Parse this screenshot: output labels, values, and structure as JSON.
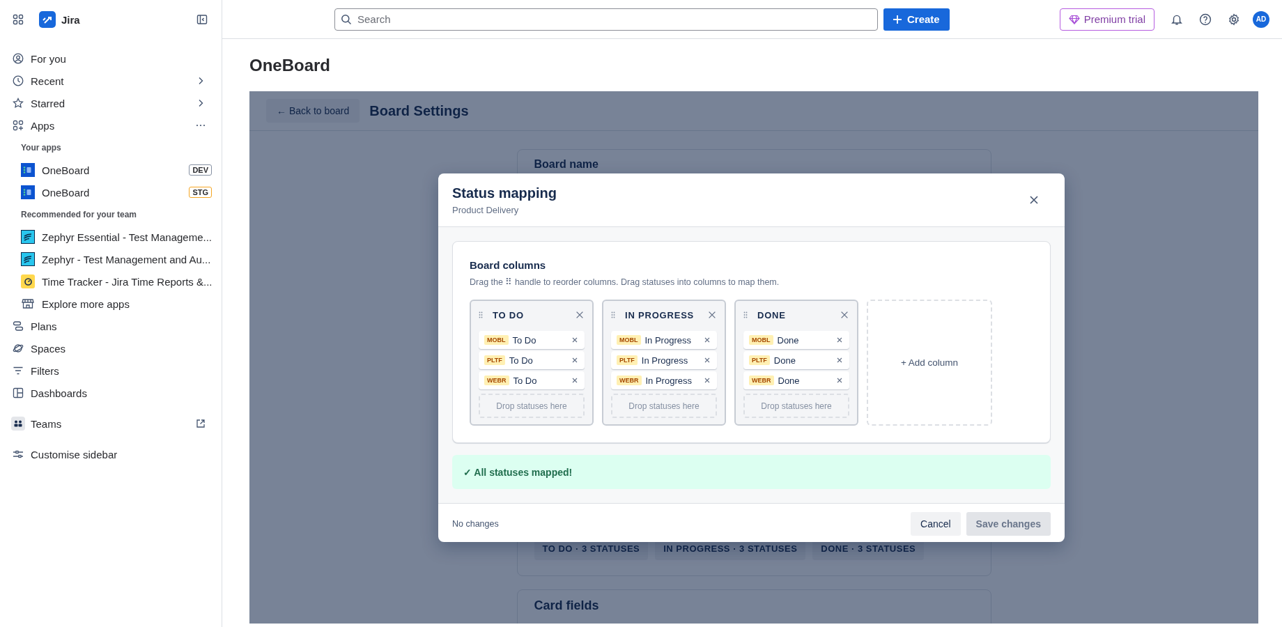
{
  "sidebar": {
    "product": "Jira",
    "groups": [
      [
        {
          "kind": "nav",
          "label": "For you"
        },
        {
          "kind": "nav",
          "label": "Recent",
          "chevron": true
        },
        {
          "kind": "nav",
          "label": "Starred",
          "chevron": true
        },
        {
          "kind": "nav",
          "label": "Apps",
          "more_menu": true
        },
        {
          "kind": "heading",
          "label": "Your apps"
        },
        {
          "kind": "app",
          "label": "OneBoard",
          "badge": {
            "text": "DEV",
            "color": "#8590a2"
          }
        },
        {
          "kind": "app",
          "label": "OneBoard",
          "badge": {
            "text": "STG",
            "color": "#f5a623"
          }
        },
        {
          "kind": "heading",
          "label": "Recommended for your team"
        },
        {
          "kind": "app",
          "label": "Zephyr Essential - Test Manageme..."
        },
        {
          "kind": "app",
          "label": "Zephyr - Test Management and Au..."
        },
        {
          "kind": "app",
          "label": "Time Tracker - Jira Time Reports &..."
        },
        {
          "kind": "app",
          "label": "Explore more apps"
        },
        {
          "kind": "nav",
          "label": "Plans"
        },
        {
          "kind": "nav",
          "label": "Spaces"
        },
        {
          "kind": "nav",
          "label": "Filters"
        },
        {
          "kind": "nav",
          "label": "Dashboards"
        }
      ],
      [
        {
          "kind": "nav",
          "label": "Teams",
          "external_link": true
        }
      ],
      [
        {
          "kind": "nav",
          "label": "Customise sidebar"
        }
      ]
    ]
  },
  "topbar": {
    "search": {
      "placeholder": "Search"
    },
    "create": "Create",
    "premium": "Premium trial",
    "avatar": "AD"
  },
  "page": {
    "title": "OneBoard"
  },
  "app": {
    "back": "← Back to board",
    "title": "Board Settings",
    "board_name_label": "Board name",
    "summary": [
      "TO DO · 3 STATUSES",
      "IN PROGRESS · 3 STATUSES",
      "DONE · 3 STATUSES"
    ],
    "card_fields_title": "Card fields"
  },
  "modal": {
    "title": "Status mapping",
    "subtitle": "Product Delivery",
    "section_title": "Board columns",
    "hint": "Drag the ⠿ handle to reorder columns. Drag statuses into columns to map them.",
    "columns": [
      {
        "title": "TO DO",
        "statuses": [
          {
            "project": "MOBL",
            "name": "To Do"
          },
          {
            "project": "PLTF",
            "name": "To Do"
          },
          {
            "project": "WEBR",
            "name": "To Do"
          }
        ],
        "drop_hint": "Drop statuses here"
      },
      {
        "title": "IN PROGRESS",
        "statuses": [
          {
            "project": "MOBL",
            "name": "In Progress"
          },
          {
            "project": "PLTF",
            "name": "In Progress"
          },
          {
            "project": "WEBR",
            "name": "In Progress"
          }
        ],
        "drop_hint": "Drop statuses here"
      },
      {
        "title": "DONE",
        "statuses": [
          {
            "project": "MOBL",
            "name": "Done"
          },
          {
            "project": "PLTF",
            "name": "Done"
          },
          {
            "project": "WEBR",
            "name": "Done"
          }
        ],
        "drop_hint": "Drop statuses here"
      }
    ],
    "add_column": "+ Add column",
    "banner": "✓ All statuses mapped!",
    "footer_status": "No changes",
    "cancel": "Cancel",
    "save": {
      "label": "Save changes",
      "disabled": true
    }
  }
}
